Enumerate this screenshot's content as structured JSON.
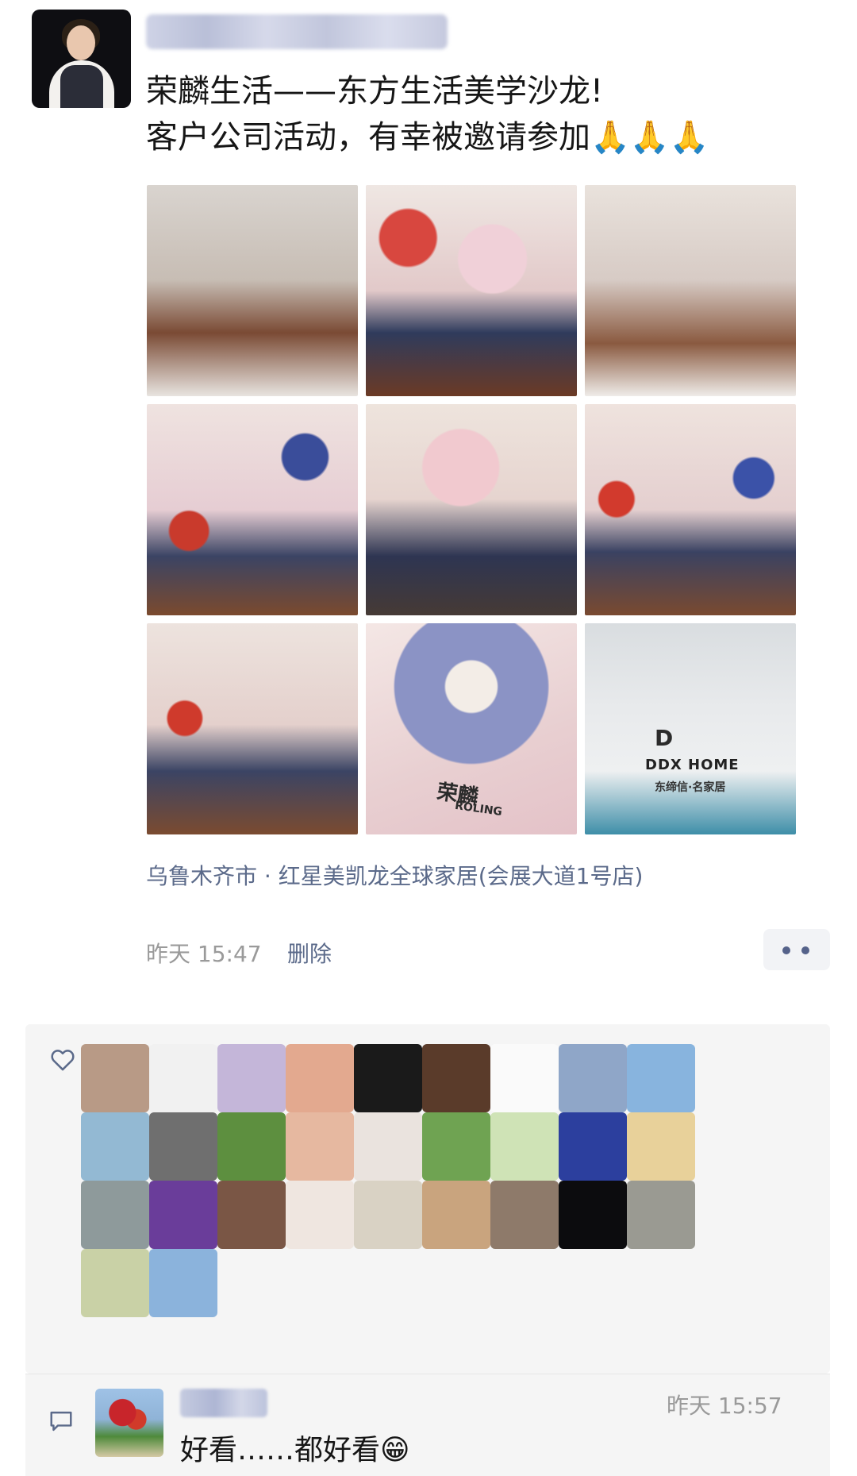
{
  "post": {
    "author_avatar": "author-avatar",
    "text_line1": "荣麟生活——东方生活美学沙龙!",
    "text_line2": "客户公司活动，有幸被邀请参加🙏🙏🙏",
    "photos": [
      {
        "label": "event-room"
      },
      {
        "label": "umbrella-wall-sofa"
      },
      {
        "label": "woman-with-umbrella"
      },
      {
        "label": "woman-on-sofa"
      },
      {
        "label": "boy-peace-sign"
      },
      {
        "label": "boy-on-sofa"
      },
      {
        "label": "woman-seated"
      },
      {
        "label": "painted-umbrella-closeup",
        "brand": "荣麟",
        "brand_sub": "ROLING"
      },
      {
        "label": "water-bottle",
        "logo": "D",
        "brand": "DDX HOME",
        "brand_sub": "东缔信·名家居"
      }
    ],
    "location": "乌鲁木齐市 · 红星美凯龙全球家居(会展大道1号店)",
    "time": "昨天 15:47",
    "delete_label": "删除",
    "more_icon": "more-dots-icon"
  },
  "likes": {
    "icon": "heart-icon",
    "avatars": [
      {
        "color": "#b89a86"
      },
      {
        "color": "#f1f1f1"
      },
      {
        "color": "#c4b6d9"
      },
      {
        "color": "#e3a98f"
      },
      {
        "color": "#1a1a1a"
      },
      {
        "color": "#5a3b2a"
      },
      {
        "color": "#fafafa"
      },
      {
        "color": "#8fa6c8"
      },
      {
        "color": "#88b4de"
      },
      {
        "color": "#93b9d3"
      },
      {
        "color": "#6f6f6f"
      },
      {
        "color": "#5d8f3f"
      },
      {
        "color": "#e6b8a0"
      },
      {
        "color": "#eae3de"
      },
      {
        "color": "#6fa352"
      },
      {
        "color": "#cfe3b6"
      },
      {
        "color": "#2c3f9e"
      },
      {
        "color": "#e8d19a"
      },
      {
        "color": "#8e9a9b"
      },
      {
        "color": "#6a3d9a"
      },
      {
        "color": "#7a5645"
      },
      {
        "color": "#efe6e0"
      },
      {
        "color": "#d9d2c4"
      },
      {
        "color": "#c9a47e"
      },
      {
        "color": "#8e7a6a"
      },
      {
        "color": "#0c0c0e"
      },
      {
        "color": "#9a9a92"
      },
      {
        "color": "#c9d1a6"
      },
      {
        "color": "#8bb3dc"
      }
    ]
  },
  "comment": {
    "icon": "comment-icon",
    "time": "昨天 15:57",
    "text": "好看……都好看😁"
  }
}
